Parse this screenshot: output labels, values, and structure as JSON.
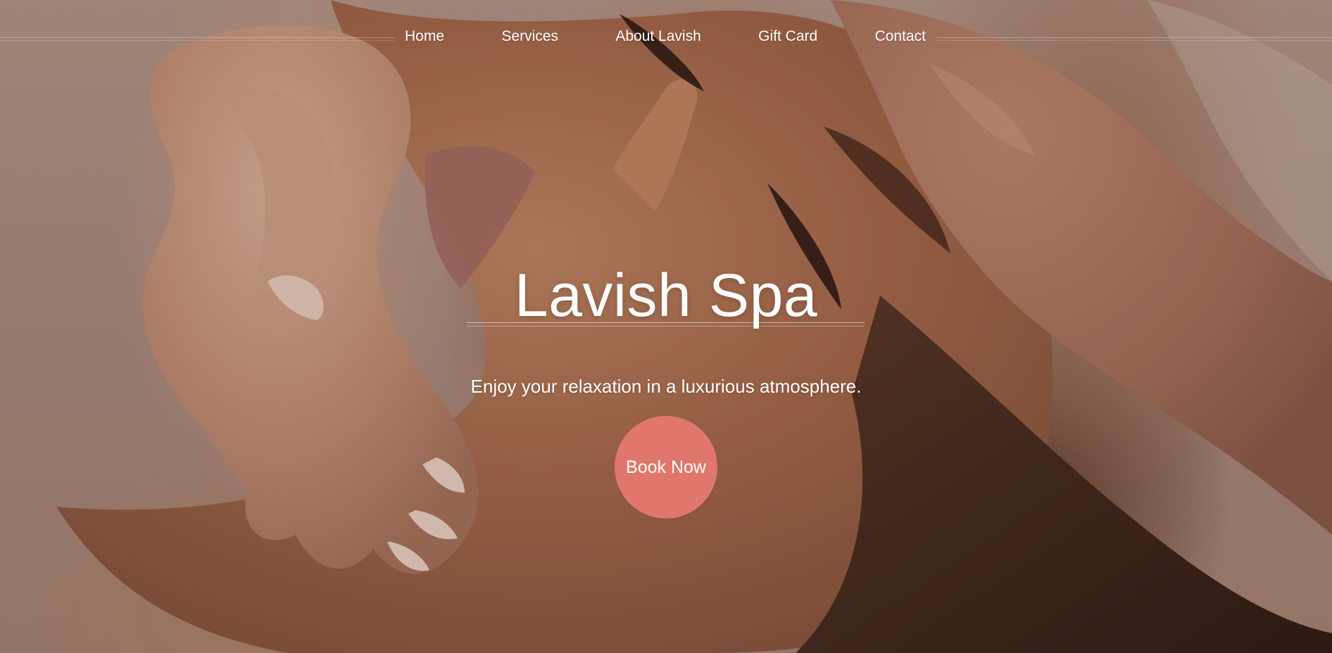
{
  "nav": {
    "items": [
      {
        "label": "Home"
      },
      {
        "label": "Services"
      },
      {
        "label": "About Lavish"
      },
      {
        "label": "Gift Card"
      },
      {
        "label": "Contact"
      }
    ]
  },
  "hero": {
    "title": "Lavish Spa",
    "subtitle": "Enjoy your relaxation in a luxurious atmosphere.",
    "cta_label": "Book Now",
    "cta_color": "#e1776c"
  }
}
